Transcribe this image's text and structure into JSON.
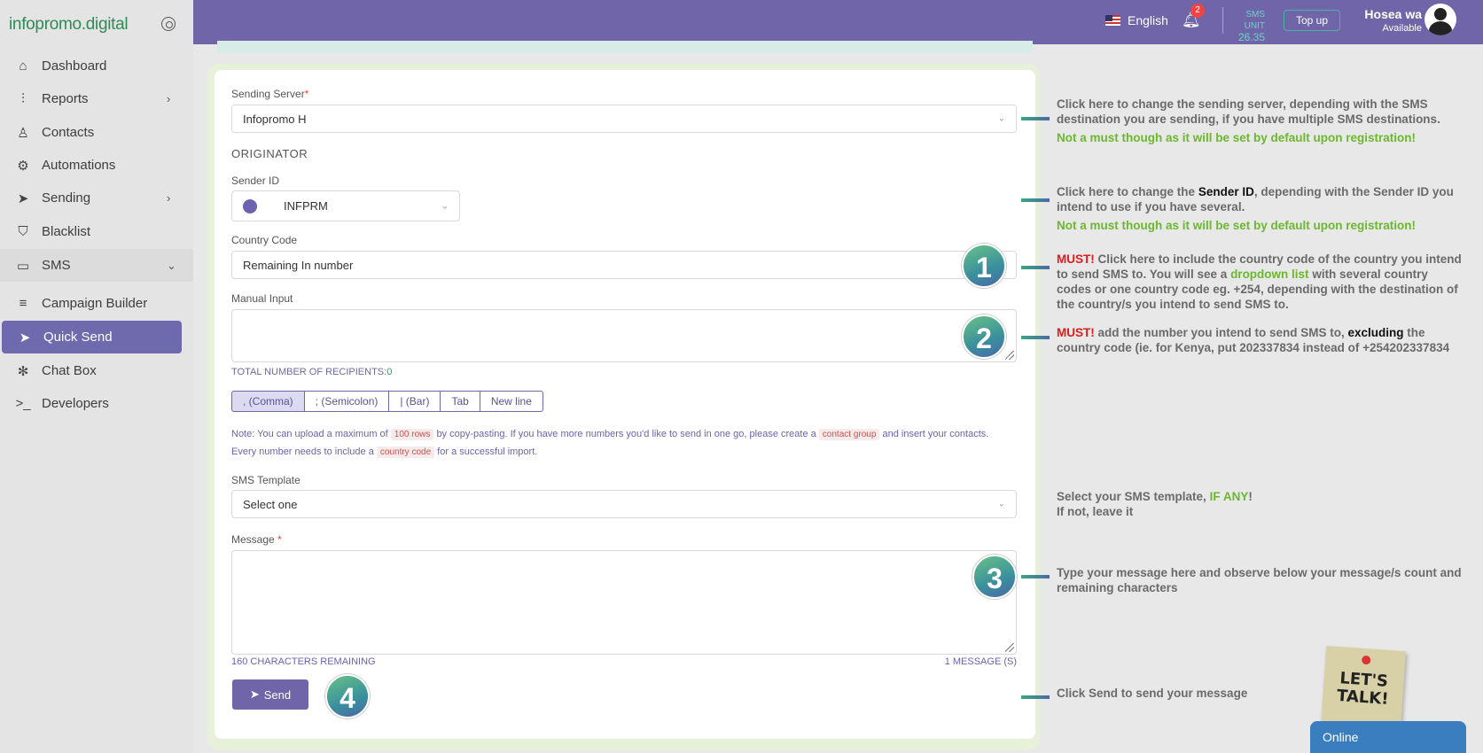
{
  "app": {
    "logo": "infopromo.digital"
  },
  "sidebar": {
    "items": [
      {
        "label": "Dashboard",
        "icon": "home-icon",
        "glyph": "⌂"
      },
      {
        "label": "Reports",
        "icon": "bar-chart-icon",
        "glyph": "⫶",
        "chevron": "›"
      },
      {
        "label": "Contacts",
        "icon": "user-icon",
        "glyph": "♙"
      },
      {
        "label": "Automations",
        "icon": "cpu-icon",
        "glyph": "⚙"
      },
      {
        "label": "Sending",
        "icon": "send-icon",
        "glyph": "➤",
        "chevron": "›"
      },
      {
        "label": "Blacklist",
        "icon": "shield-icon",
        "glyph": "⛉"
      },
      {
        "label": "SMS",
        "icon": "message-icon",
        "glyph": "▭",
        "chevron": "⌄"
      },
      {
        "label": "Campaign Builder",
        "icon": "list-icon",
        "glyph": "≡"
      },
      {
        "label": "Quick Send",
        "icon": "send-icon",
        "glyph": "➤"
      },
      {
        "label": "Chat Box",
        "icon": "chat-icon",
        "glyph": "✻"
      },
      {
        "label": "Developers",
        "icon": "terminal-icon",
        "glyph": ">_"
      }
    ]
  },
  "header": {
    "language": "English",
    "notification_count": "2",
    "sms_unit_label": "SMS UNIT",
    "sms_unit_value": "26.35",
    "topup_label": "Top up",
    "user_name": "Hosea wa",
    "user_status": "Available"
  },
  "form": {
    "sending_server_label": "Sending Server",
    "sending_server_value": "Infopromo H",
    "originator_title": "ORIGINATOR",
    "sender_id_label": "Sender ID",
    "sender_id_value": "INFPRM",
    "country_code_label": "Country Code",
    "country_code_value": "Remaining In number",
    "manual_input_label": "Manual Input",
    "recipients_label": "TOTAL NUMBER OF RECIPIENTS:",
    "recipients_count": "0",
    "separators": [
      ", (Comma)",
      "; (Semicolon)",
      "| (Bar)",
      "Tab",
      "New line"
    ],
    "note_prefix": "Note: You can upload a maximum of",
    "note_rows": "100 rows",
    "note_mid": "by copy-pasting. If you have more numbers you'd like to send in one go, please create a",
    "note_group": "contact group",
    "note_mid2": "and insert your contacts. Every number needs to include a",
    "note_code": "country code",
    "note_suffix": "for a successful import.",
    "sms_template_label": "SMS Template",
    "sms_template_value": "Select one",
    "message_label": "Message",
    "chars_remaining": "160 CHARACTERS REMAINING",
    "message_count": "1 MESSAGE (S)",
    "send_label": "Send"
  },
  "steps": [
    "1",
    "2",
    "3",
    "4"
  ],
  "annotations": {
    "server_text": "Click here to change the sending server, depending with the SMS destination you are sending, if you have multiple SMS destinations.",
    "server_sub": "Not a must though as it will be set by default upon registration!",
    "sender_a": "Click here to change the",
    "sender_b": "Sender ID",
    "sender_c": ", depending with the Sender ID you intend to use if you have several.",
    "sender_sub": "Not a must though as it will be set by default upon registration!",
    "country_must": "MUST!",
    "country_a": " Click here to include the country code of the country you intend to send SMS to. You will see a",
    "country_b": "dropdown list",
    "country_c": " with several country codes or one country code eg. +254, depending with the destination of the country/s you intend to send SMS to.",
    "manual_must": "MUST!",
    "manual_a": " add the number you intend to send SMS to,",
    "manual_b": "excluding",
    "manual_c": " the country code (ie. for Kenya, put 202337834 instead of +254202337834",
    "template_a": "Select your SMS template,",
    "template_b": "IF ANY",
    "template_c": "!",
    "template_d": "If not, leave it",
    "message_text": "Type your message here and observe below your message/s count and remaining characters",
    "send_text": "Click Send to send your message"
  },
  "widgets": {
    "lets_talk_a": "LET'S",
    "lets_talk_b": "TALK!",
    "chat_status": "Online"
  }
}
